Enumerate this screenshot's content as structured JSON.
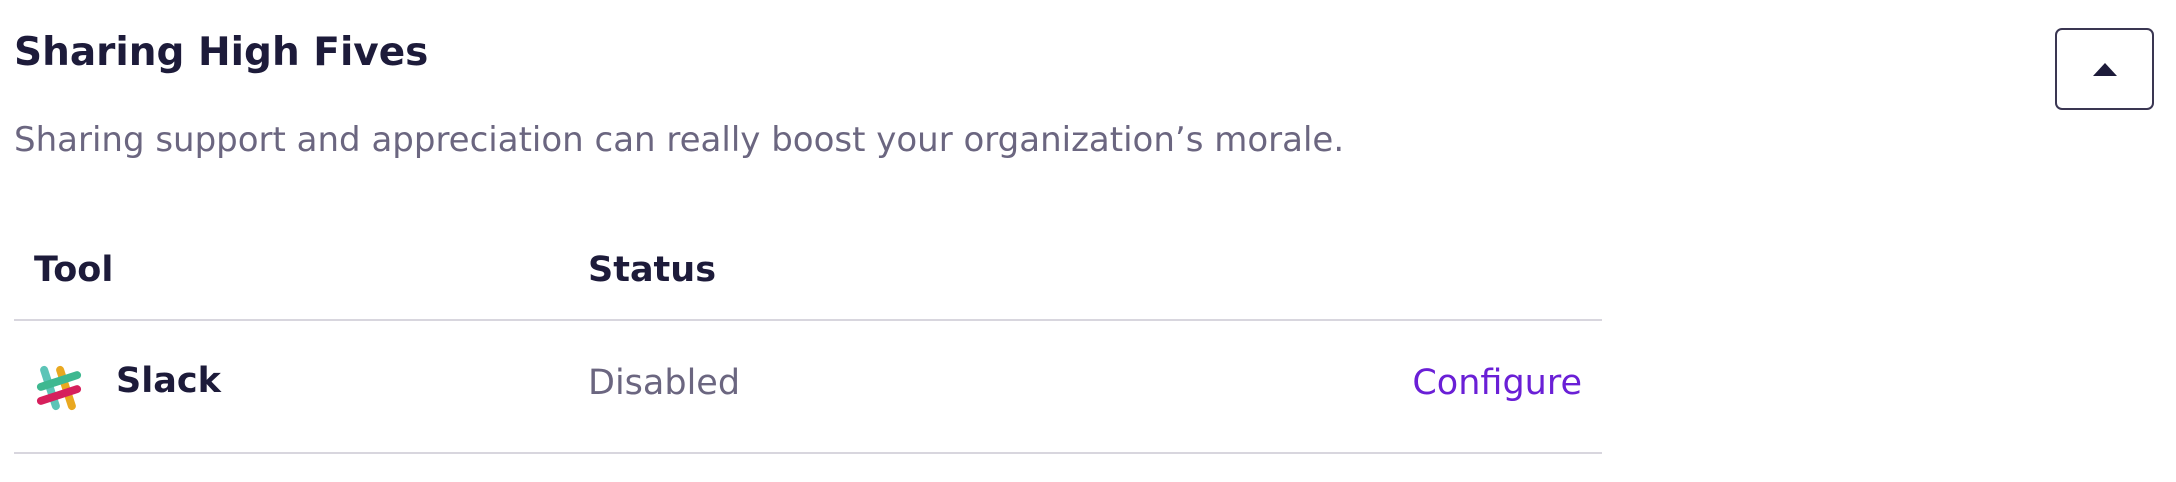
{
  "section": {
    "title": "Sharing High Fives",
    "description": "Sharing support and appreciation can really boost your organization’s morale.",
    "collapse_icon": "caret-up-icon"
  },
  "table": {
    "columns": [
      "Tool",
      "Status"
    ],
    "rows": [
      {
        "icon": "slack-logo-icon",
        "tool": "Slack",
        "status": "Disabled",
        "action": "Configure"
      }
    ]
  },
  "colors": {
    "heading": "#1d1b3a",
    "muted_text": "#6b6680",
    "link": "#6a1fd6",
    "divider": "#d8d6de"
  }
}
